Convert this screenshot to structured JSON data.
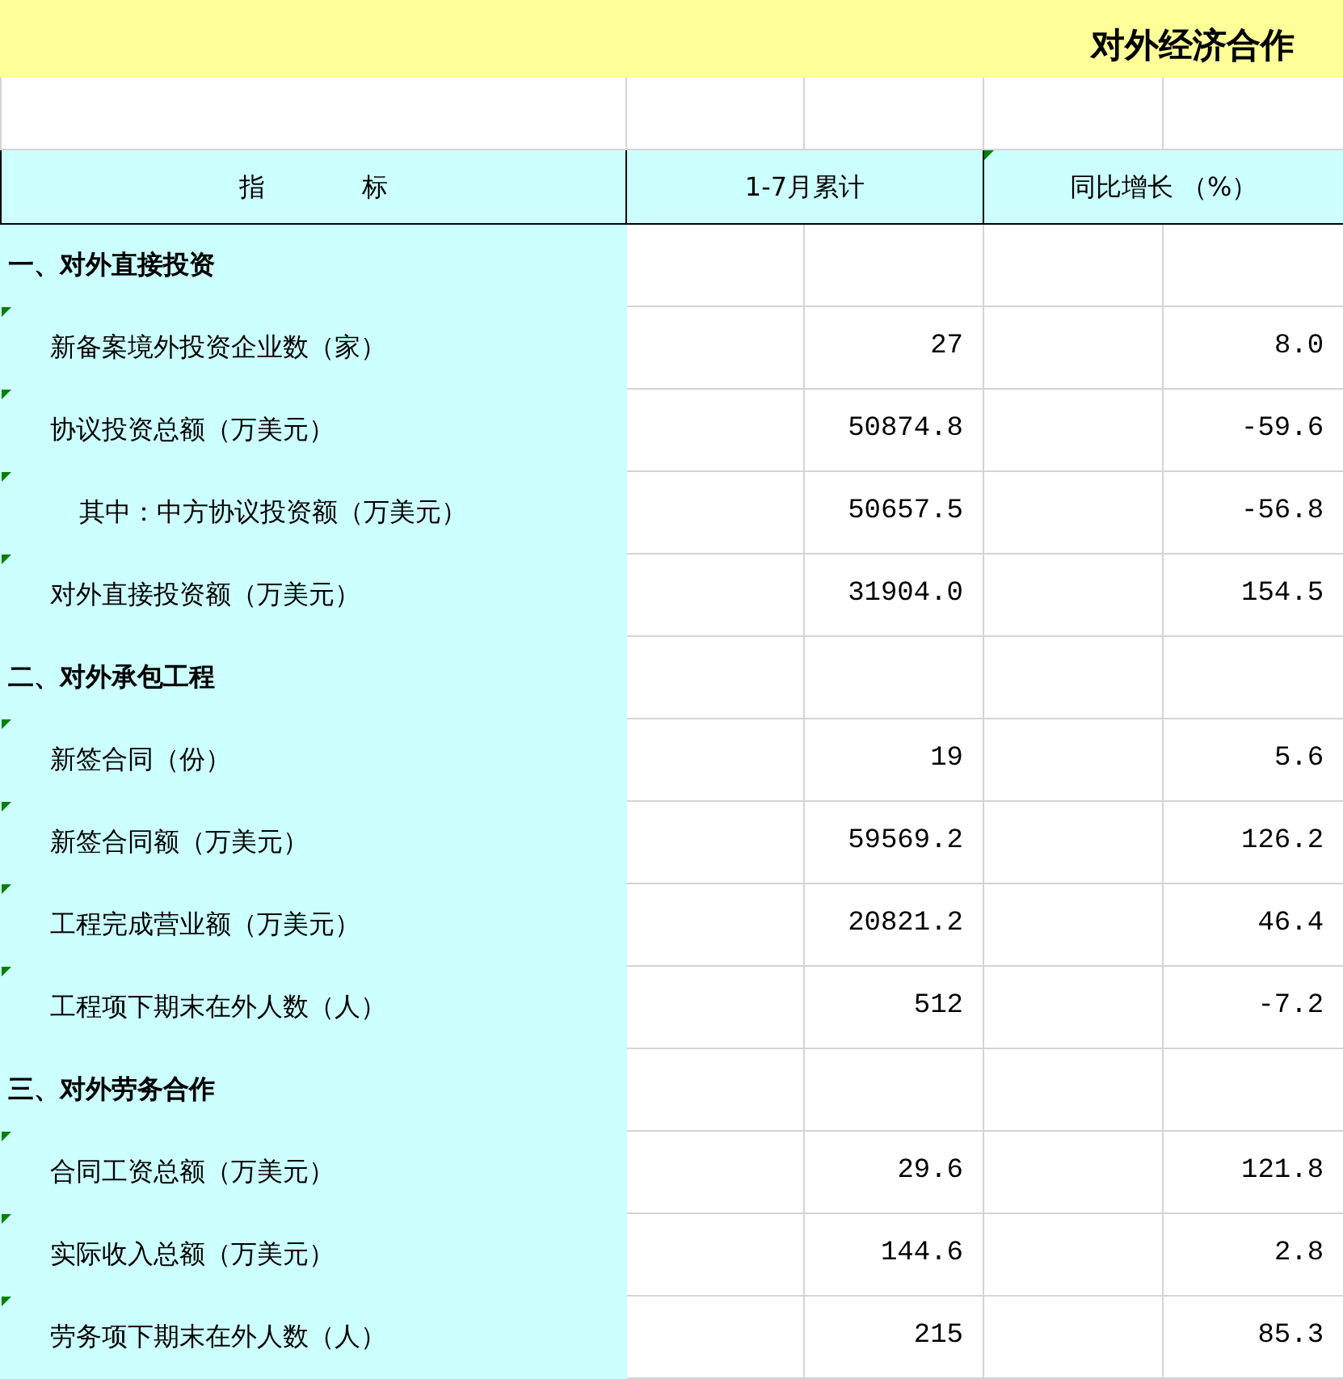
{
  "title": "对外经济合作",
  "header": {
    "indicator": [
      "指",
      "标"
    ],
    "cumulative": "1-7月累计",
    "growth": "同比增长 （%）",
    "growth_marked": true
  },
  "rows": [
    {
      "kind": "section",
      "label": "一、对外直接投资",
      "marked": false
    },
    {
      "kind": "item",
      "label": "新备案境外投资企业数（家）",
      "value": "27",
      "growth": "8.0",
      "marked": true
    },
    {
      "kind": "item",
      "label": "协议投资总额（万美元）",
      "value": "50874.8",
      "growth": "-59.6",
      "marked": true,
      "children": [
        {
          "kind": "item",
          "label": "其中：中方协议投资额（万美元）",
          "value": "50657.5",
          "growth": "-56.8",
          "marked": true
        }
      ]
    },
    {
      "kind": "item",
      "label": "对外直接投资额（万美元）",
      "value": "31904.0",
      "growth": "154.5",
      "marked": true
    },
    {
      "kind": "section",
      "label": "二、对外承包工程",
      "marked": false
    },
    {
      "kind": "item",
      "label": "新签合同（份）",
      "value": "19",
      "growth": "5.6",
      "marked": true
    },
    {
      "kind": "item",
      "label": "新签合同额（万美元）",
      "value": "59569.2",
      "growth": "126.2",
      "marked": true
    },
    {
      "kind": "item",
      "label": "工程完成营业额（万美元）",
      "value": "20821.2",
      "growth": "46.4",
      "marked": true
    },
    {
      "kind": "item",
      "label": "工程项下期末在外人数（人）",
      "value": "512",
      "growth": "-7.2",
      "marked": true
    },
    {
      "kind": "section",
      "label": "三、对外劳务合作",
      "marked": false
    },
    {
      "kind": "item",
      "label": "合同工资总额（万美元）",
      "value": "29.6",
      "growth": "121.8",
      "marked": true
    },
    {
      "kind": "item",
      "label": "实际收入总额（万美元）",
      "value": "144.6",
      "growth": "2.8",
      "marked": true
    },
    {
      "kind": "item",
      "label": "劳务项下期末在外人数（人）",
      "value": "215",
      "growth": "85.3",
      "marked": true
    }
  ]
}
